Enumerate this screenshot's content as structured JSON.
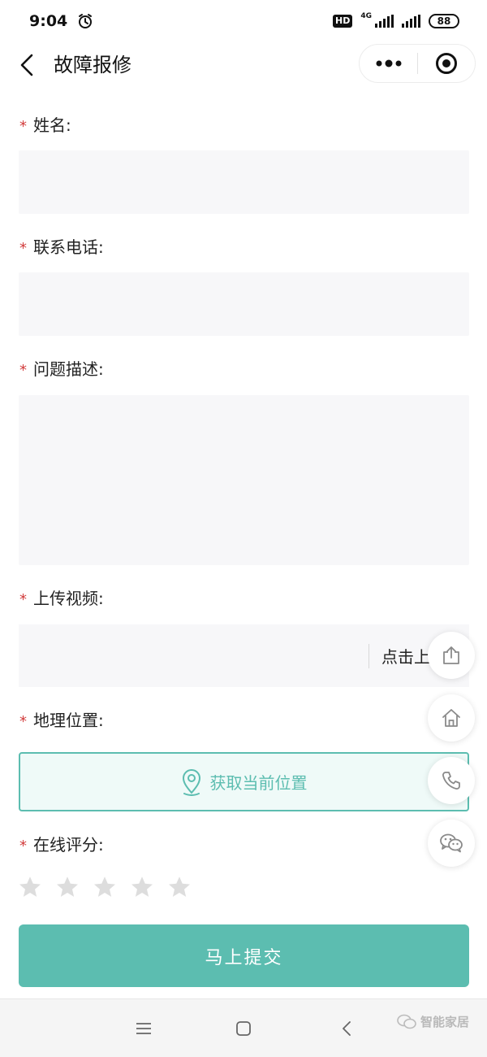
{
  "status_bar": {
    "time": "9:04",
    "hd": "HD",
    "network": "4G",
    "battery": "88"
  },
  "nav": {
    "title": "故障报修"
  },
  "form": {
    "required_mark": "*",
    "name_label": "姓名:",
    "phone_label": "联系电话:",
    "desc_label": "问题描述:",
    "video_label": "上传视频:",
    "upload_text": "点击上传",
    "location_label": "地理位置:",
    "location_button": "获取当前位置",
    "rating_label": "在线评分:",
    "rating_value": 0,
    "rating_max": 5,
    "submit_button": "马上提交"
  },
  "watermark": "智能家居",
  "colors": {
    "accent": "#5cbdb0",
    "required": "#d23c3c",
    "input_bg": "#f7f7f9",
    "star_empty": "#dddddd"
  }
}
